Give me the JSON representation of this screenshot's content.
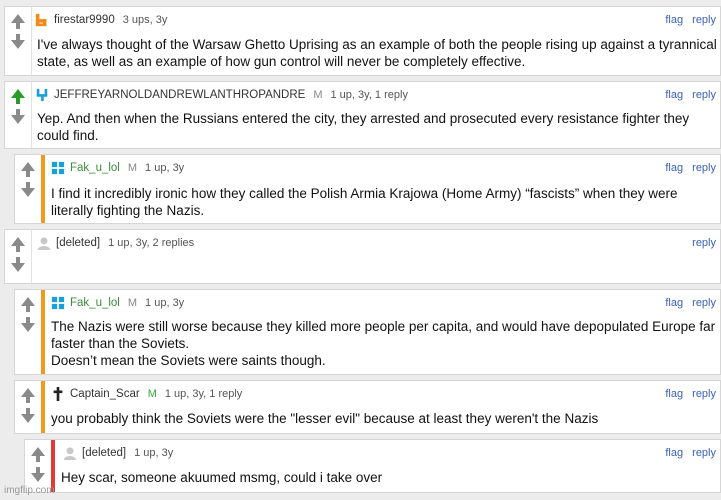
{
  "comments": [
    {
      "username": "firestar9990",
      "mod_badge": "",
      "meta": "3 ups, 3y",
      "links": [
        "flag",
        "reply"
      ],
      "text": "I've always thought of the Warsaw Ghetto Uprising as an example of both the people rising up against a tyrannical state, as well as an example of how gun control will never be completely effective."
    },
    {
      "username": "JEFFREYARNOLDANDREWLANTHROPANDRE",
      "mod_badge": "M",
      "meta": "1 up, 3y, 1 reply",
      "links": [
        "flag",
        "reply"
      ],
      "text": "Yep. And then when the Russians entered the city, they arrested and prosecuted every resistance fighter they could find."
    },
    {
      "username": "Fak_u_lol",
      "mod_badge": "M",
      "meta": "1 up, 3y",
      "links": [
        "flag",
        "reply"
      ],
      "text": "I find it incredibly ironic how they called the Polish Armia Krajowa (Home Army) “fascists” when they were literally fighting the Nazis."
    },
    {
      "username": "[deleted]",
      "mod_badge": "",
      "meta": "1 up, 3y, 2 replies",
      "links": [
        "reply"
      ],
      "text": ""
    },
    {
      "username": "Fak_u_lol",
      "mod_badge": "M",
      "meta": "1 up, 3y",
      "links": [
        "flag",
        "reply"
      ],
      "text": "The Nazis were still worse because they killed more people per capita, and would have depopulated Europe far faster than the Soviets.",
      "text2": "Doesn’t mean the Soviets were saints though."
    },
    {
      "username": "Captain_Scar",
      "mod_badge": "M",
      "meta": "1 up, 3y, 1 reply",
      "links": [
        "flag",
        "reply"
      ],
      "text": "you probably think the Soviets were the \"lesser evil\" because at least they weren't the Nazis"
    },
    {
      "username": "[deleted]",
      "mod_badge": "",
      "meta": "1 up, 3y",
      "links": [
        "flag",
        "reply"
      ],
      "text": "Hey scar, someone akuumed msmg, could i take over"
    }
  ],
  "watermark": "imgflip.com",
  "colors": {
    "link": "#3a62b8",
    "stripe_orange": "#f39a1e",
    "stripe_red": "#e03a3a",
    "upvote_active": "#2a9a2a",
    "mod_green": "#3aa13a"
  }
}
